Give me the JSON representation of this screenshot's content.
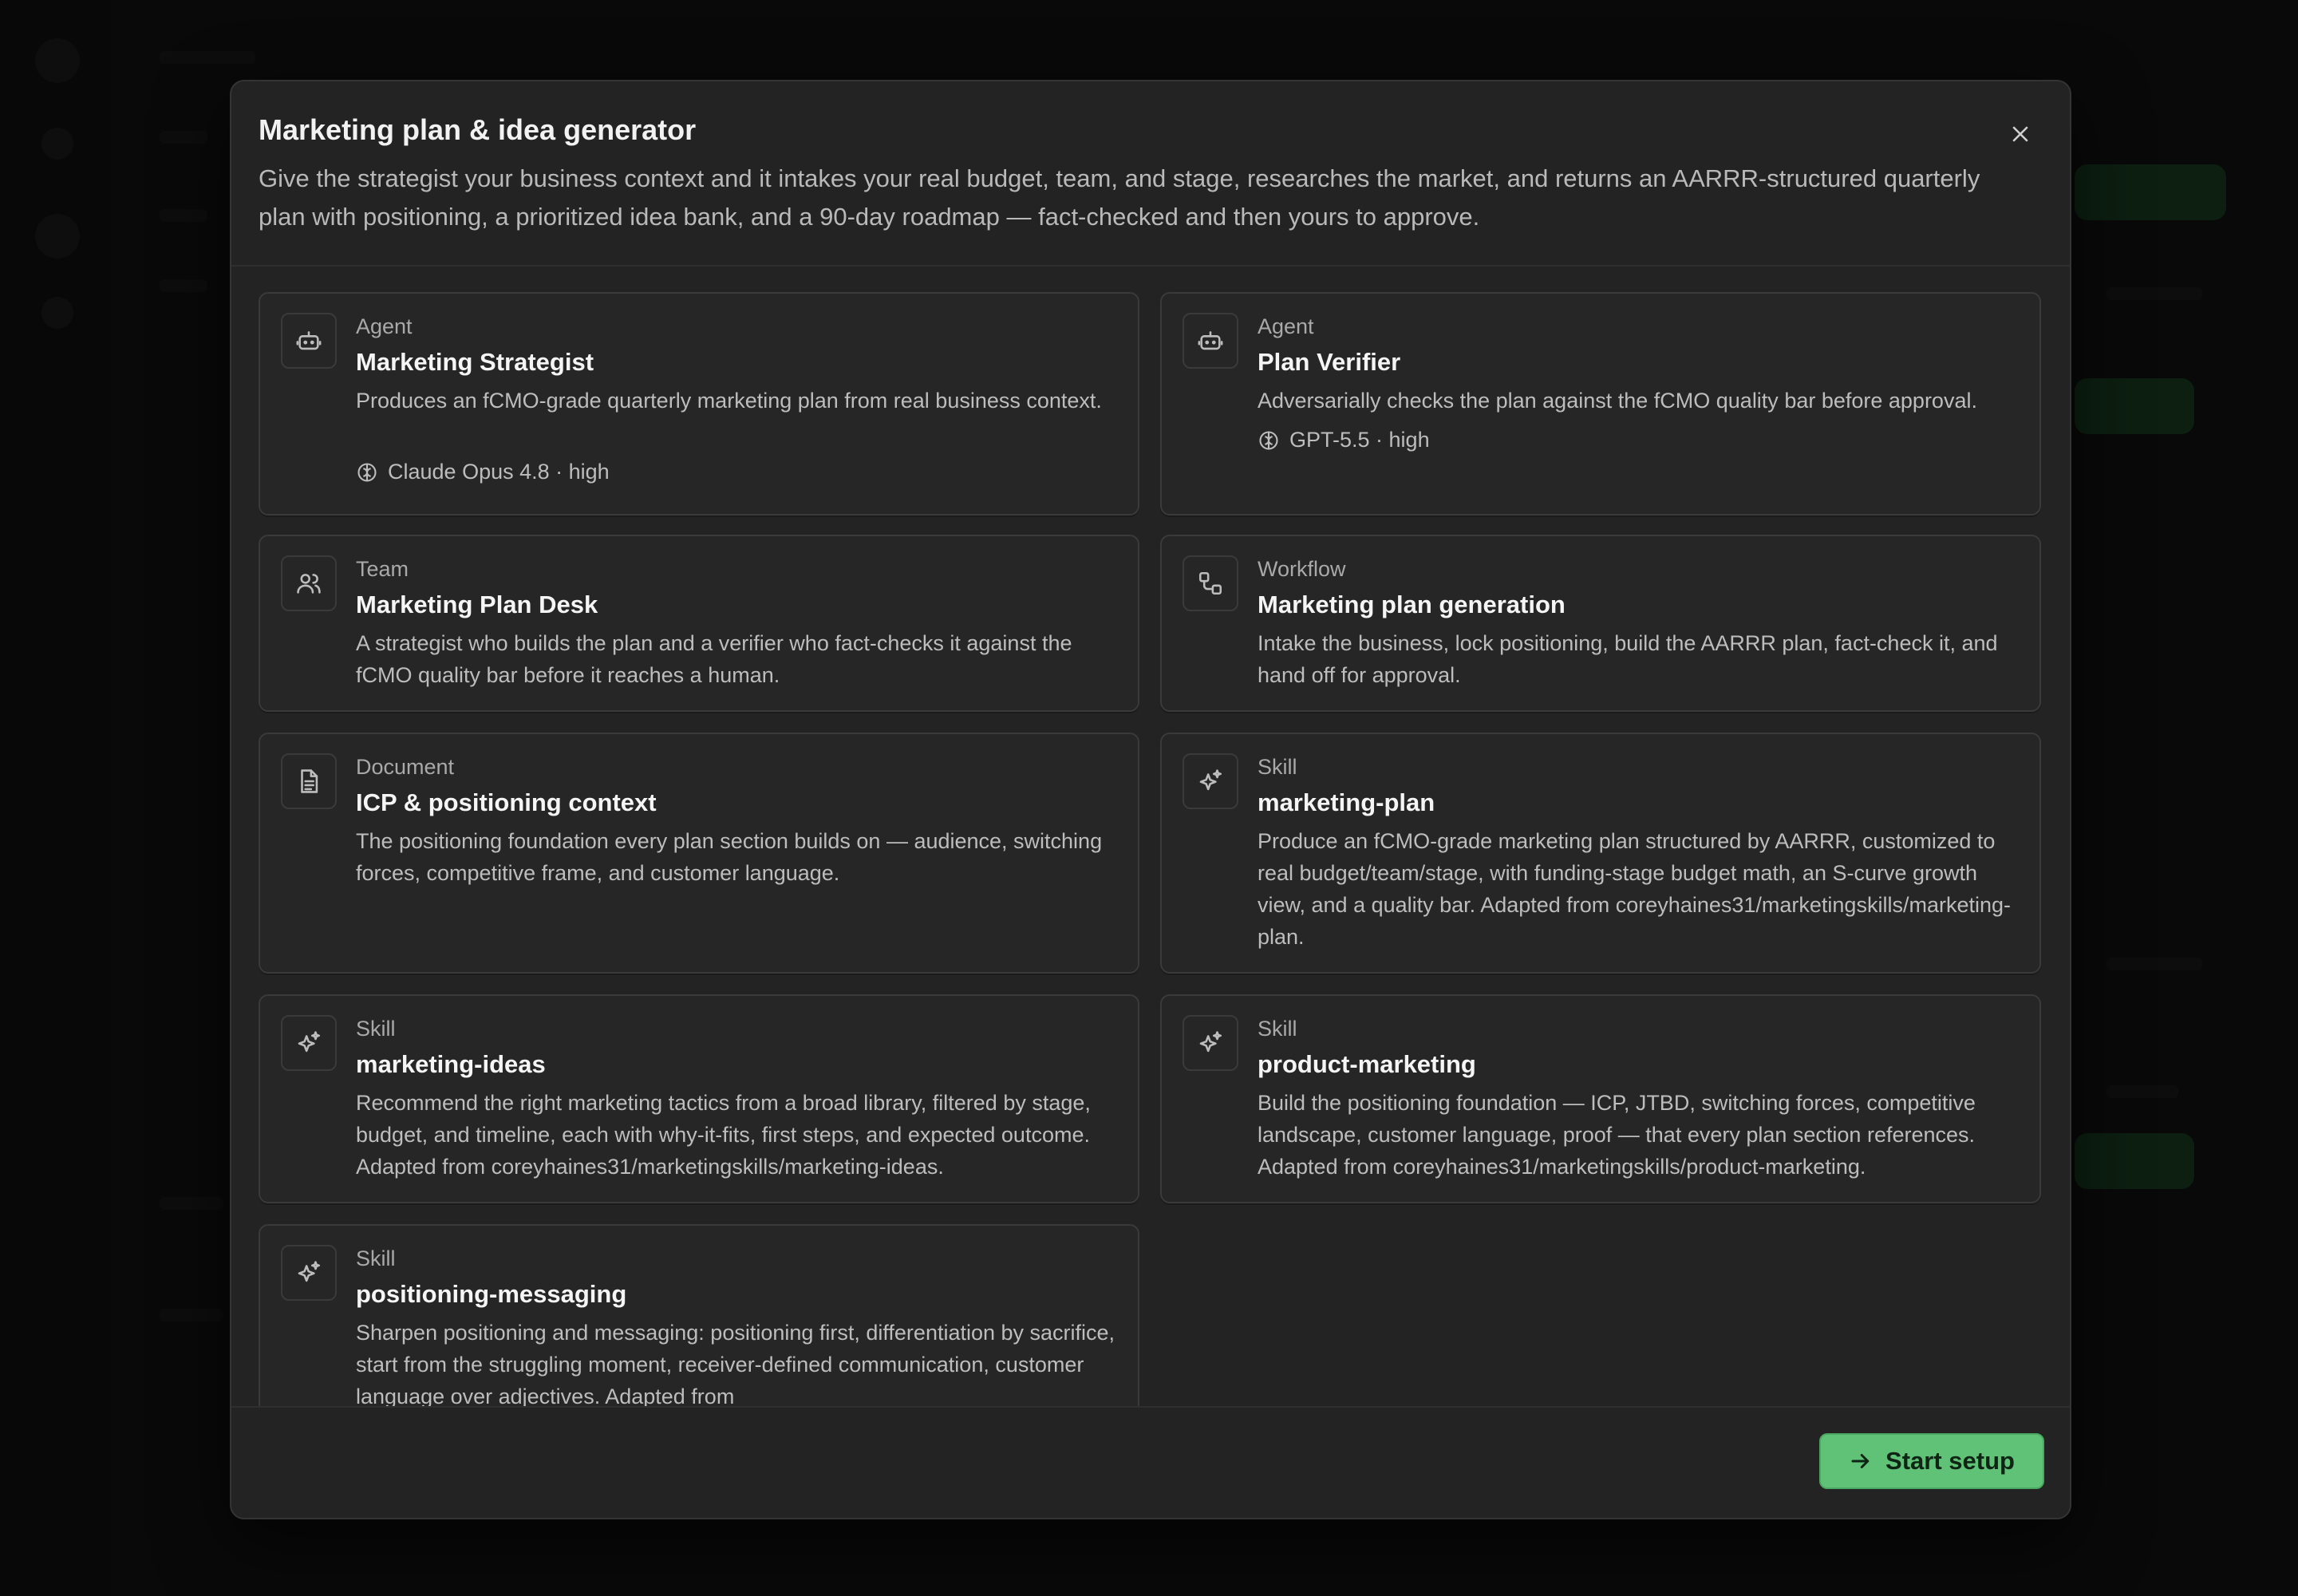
{
  "modal": {
    "title": "Marketing plan & idea generator",
    "description": "Give the strategist your business context and it intakes your real budget, team, and stage, researches the market, and returns an AARRR-structured quarterly plan with positioning, a prioritized idea bank, and a 90-day roadmap — fact-checked and then yours to approve.",
    "close_icon": "close-icon"
  },
  "cards": [
    {
      "type": "Agent",
      "title": "Marketing Strategist",
      "description": "Produces an fCMO-grade quarterly marketing plan from real business context.",
      "model": "Claude Opus 4.8 · high",
      "icon": "bot-icon"
    },
    {
      "type": "Agent",
      "title": "Plan Verifier",
      "description": "Adversarially checks the plan against the fCMO quality bar before approval.",
      "model": "GPT-5.5 · high",
      "icon": "bot-icon"
    },
    {
      "type": "Team",
      "title": "Marketing Plan Desk",
      "description": "A strategist who builds the plan and a verifier who fact-checks it against the fCMO quality bar before it reaches a human.",
      "icon": "users-icon"
    },
    {
      "type": "Workflow",
      "title": "Marketing plan generation",
      "description": "Intake the business, lock positioning, build the AARRR plan, fact-check it, and hand off for approval.",
      "icon": "workflow-icon"
    },
    {
      "type": "Document",
      "title": "ICP & positioning context",
      "description": "The positioning foundation every plan section builds on — audience, switching forces, competitive frame, and customer language.",
      "icon": "document-icon"
    },
    {
      "type": "Skill",
      "title": "marketing-plan",
      "description": "Produce an fCMO-grade marketing plan structured by AARRR, customized to real budget/team/stage, with funding-stage budget math, an S-curve growth view, and a quality bar. Adapted from coreyhaines31/marketingskills/marketing-plan.",
      "icon": "sparkles-icon"
    },
    {
      "type": "Skill",
      "title": "marketing-ideas",
      "description": "Recommend the right marketing tactics from a broad library, filtered by stage, budget, and timeline, each with why-it-fits, first steps, and expected outcome. Adapted from coreyhaines31/marketingskills/marketing-ideas.",
      "icon": "sparkles-icon"
    },
    {
      "type": "Skill",
      "title": "product-marketing",
      "description": "Build the positioning foundation — ICP, JTBD, switching forces, competitive landscape, customer language, proof — that every plan section references. Adapted from coreyhaines31/marketingskills/product-marketing.",
      "icon": "sparkles-icon"
    },
    {
      "type": "Skill",
      "title": "positioning-messaging",
      "description": "Sharpen positioning and messaging: positioning first, differentiation by sacrifice, start from the struggling moment, receiver-defined communication, customer language over adjectives. Adapted from",
      "icon": "sparkles-icon"
    }
  ],
  "footer": {
    "start_label": "Start setup",
    "start_icon": "arrow-right-icon"
  },
  "colors": {
    "accent": "#5fc276",
    "modal_bg": "#232323",
    "card_bg": "#262626"
  }
}
